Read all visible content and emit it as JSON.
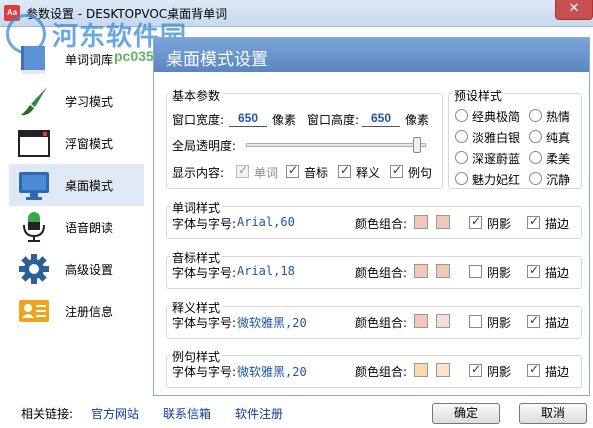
{
  "window": {
    "title": "参数设置 - DESKTOPVOC桌面背单词",
    "app_icon_text": "Aa",
    "close_symbol": "✕"
  },
  "watermark": {
    "text": "河东软件园",
    "sub": "pc0359"
  },
  "sidebar": {
    "items": [
      {
        "label": "单词词库",
        "icon": "book-icon"
      },
      {
        "label": "学习模式",
        "icon": "brush-icon"
      },
      {
        "label": "浮窗模式",
        "icon": "window-icon"
      },
      {
        "label": "桌面模式",
        "icon": "monitor-icon"
      },
      {
        "label": "语音朗读",
        "icon": "microphone-icon"
      },
      {
        "label": "高级设置",
        "icon": "gear-icon"
      },
      {
        "label": "注册信息",
        "icon": "id-card-icon"
      }
    ],
    "active": 3
  },
  "panel": {
    "title": "桌面模式设置"
  },
  "basic": {
    "title": "基本参数",
    "width_label": "窗口宽度:",
    "width_value": "650",
    "unit": "像素",
    "height_label": "窗口高度:",
    "height_value": "650",
    "opacity_label": "全局透明度:",
    "opacity_level": 0.97,
    "display_label": "显示内容:",
    "display_options": [
      {
        "label": "单词",
        "checked": true,
        "disabled": true
      },
      {
        "label": "音标",
        "checked": true,
        "disabled": false
      },
      {
        "label": "释义",
        "checked": true,
        "disabled": false
      },
      {
        "label": "例句",
        "checked": true,
        "disabled": false
      }
    ]
  },
  "presets": {
    "title": "预设样式",
    "options": [
      "经典极简",
      "热情",
      "淡雅白银",
      "纯真",
      "深邃蔚蓝",
      "柔美",
      "魅力妃红",
      "沉静"
    ]
  },
  "styles": [
    {
      "title": "单词样式",
      "font_label": "字体与字号:",
      "font_value": "Arial,60",
      "color_label": "颜色组合:",
      "colors": [
        "#f2c6b8",
        "#f2c6b8"
      ],
      "shadow_label": "阴影",
      "shadow": true,
      "stroke_label": "描边",
      "stroke": true
    },
    {
      "title": "音标样式",
      "font_label": "字体与字号:",
      "font_value": "Arial,18",
      "color_label": "颜色组合:",
      "colors": [
        "#f2c6b8",
        "#f2c6b8"
      ],
      "shadow_label": "阴影",
      "shadow": false,
      "stroke_label": "描边",
      "stroke": true
    },
    {
      "title": "释义样式",
      "font_label": "字体与字号:",
      "font_value": "微软雅黑,20",
      "color_label": "颜色组合:",
      "colors": [
        "#f2c6b8",
        "#f5ded6"
      ],
      "shadow_label": "阴影",
      "shadow": false,
      "stroke_label": "描边",
      "stroke": true
    },
    {
      "title": "例句样式",
      "font_label": "字体与字号:",
      "font_value": "微软雅黑,20",
      "color_label": "颜色组合:",
      "colors": [
        "#fad9b3",
        "#fce2c6"
      ],
      "shadow_label": "阴影",
      "shadow": true,
      "stroke_label": "描边",
      "stroke": true
    }
  ],
  "footer": {
    "links_label": "相关链接:",
    "links": [
      "官方网站",
      "联系信箱",
      "软件注册"
    ],
    "ok_label": "确定",
    "cancel_label": "取消"
  },
  "colors": {
    "header_bg": "#5a87c2",
    "link": "#0a3a9a",
    "value_text": "#1d56a8"
  }
}
